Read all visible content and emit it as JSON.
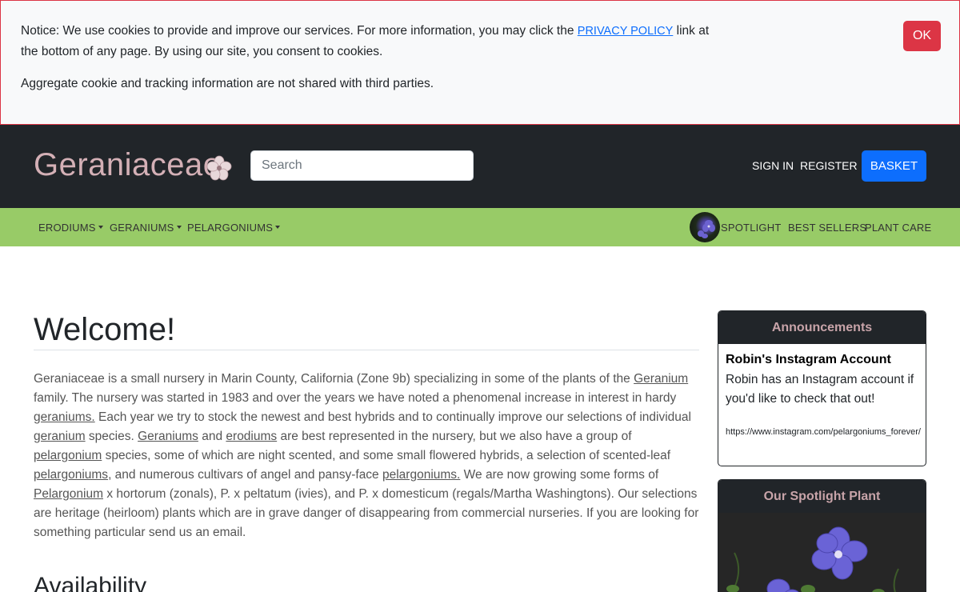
{
  "cookie": {
    "notice_before": "Notice: We use cookies to provide and improve our services. For more information, you may click the ",
    "privacy_link": "PRIVACY POLICY",
    "notice_after": " link at the bottom of any page. By using our site, you consent to cookies.",
    "second_line": "Aggregate cookie and tracking information are not shared with third parties.",
    "ok_label": "OK"
  },
  "header": {
    "brand": "Geraniaceae",
    "search_placeholder": "Search",
    "sign_in": "SIGN IN",
    "register": "REGISTER",
    "basket": "BASKET"
  },
  "nav": {
    "left": [
      "ERODIUMS",
      "GERANIUMS",
      "PELARGONIUMS"
    ],
    "right": [
      "SPOTLIGHT",
      "BEST SELLERS",
      "PLANT CARE"
    ]
  },
  "main": {
    "welcome": "Welcome!",
    "intro": [
      {
        "t": "Geraniaceae is a small nursery in Marin County, California (Zone 9b) specializing in some of the plants of the ",
        "u": false
      },
      {
        "t": "Geranium",
        "u": true
      },
      {
        "t": " family. The nursery was started in 1983 and over the years we have noted a phenomenal increase in interest in hardy ",
        "u": false
      },
      {
        "t": "geraniums.",
        "u": true
      },
      {
        "t": " Each year we try to stock the newest and best hybrids and to continually improve our selections of individual ",
        "u": false
      },
      {
        "t": "geranium",
        "u": true
      },
      {
        "t": " species. ",
        "u": false
      },
      {
        "t": "Geraniums",
        "u": true
      },
      {
        "t": " and ",
        "u": false
      },
      {
        "t": "erodiums",
        "u": true
      },
      {
        "t": " are best represented in the nursery, but we also have a group of ",
        "u": false
      },
      {
        "t": "pelargonium",
        "u": true
      },
      {
        "t": " species, some of which are night scented, and some small flowered hybrids, a selection of scented-leaf ",
        "u": false
      },
      {
        "t": "pelargoniums",
        "u": true
      },
      {
        "t": ", and numerous cultivars of angel and pansy-face ",
        "u": false
      },
      {
        "t": "pelargoniums.",
        "u": true
      },
      {
        "t": " We are now growing some forms of ",
        "u": false
      },
      {
        "t": "Pelargonium",
        "u": true
      },
      {
        "t": " x hortorum (zonals), P. x peltatum (ivies), and P. x domesticum (regals/Martha Washingtons). Our selections are heritage (heirloom) plants which are in grave danger of disappearing from commercial nurseries. If you are looking for something particular send us an email.",
        "u": false
      }
    ],
    "availability": "Availability"
  },
  "sidebar": {
    "announcements_title": "Announcements",
    "ann_item_title": "Robin's Instagram Account",
    "ann_item_body": "Robin has an Instagram account if you'd like to check that out!",
    "ann_item_link": "https://www.instagram.com/pelargoniums_forever/",
    "spotlight_title": "Our Spotlight Plant"
  },
  "colors": {
    "header_bg": "#212529",
    "nav_green": "#98cb67",
    "brand_pink": "#d4b0b6",
    "ok_red": "#dc3545",
    "basket_blue": "#0d6efd"
  }
}
